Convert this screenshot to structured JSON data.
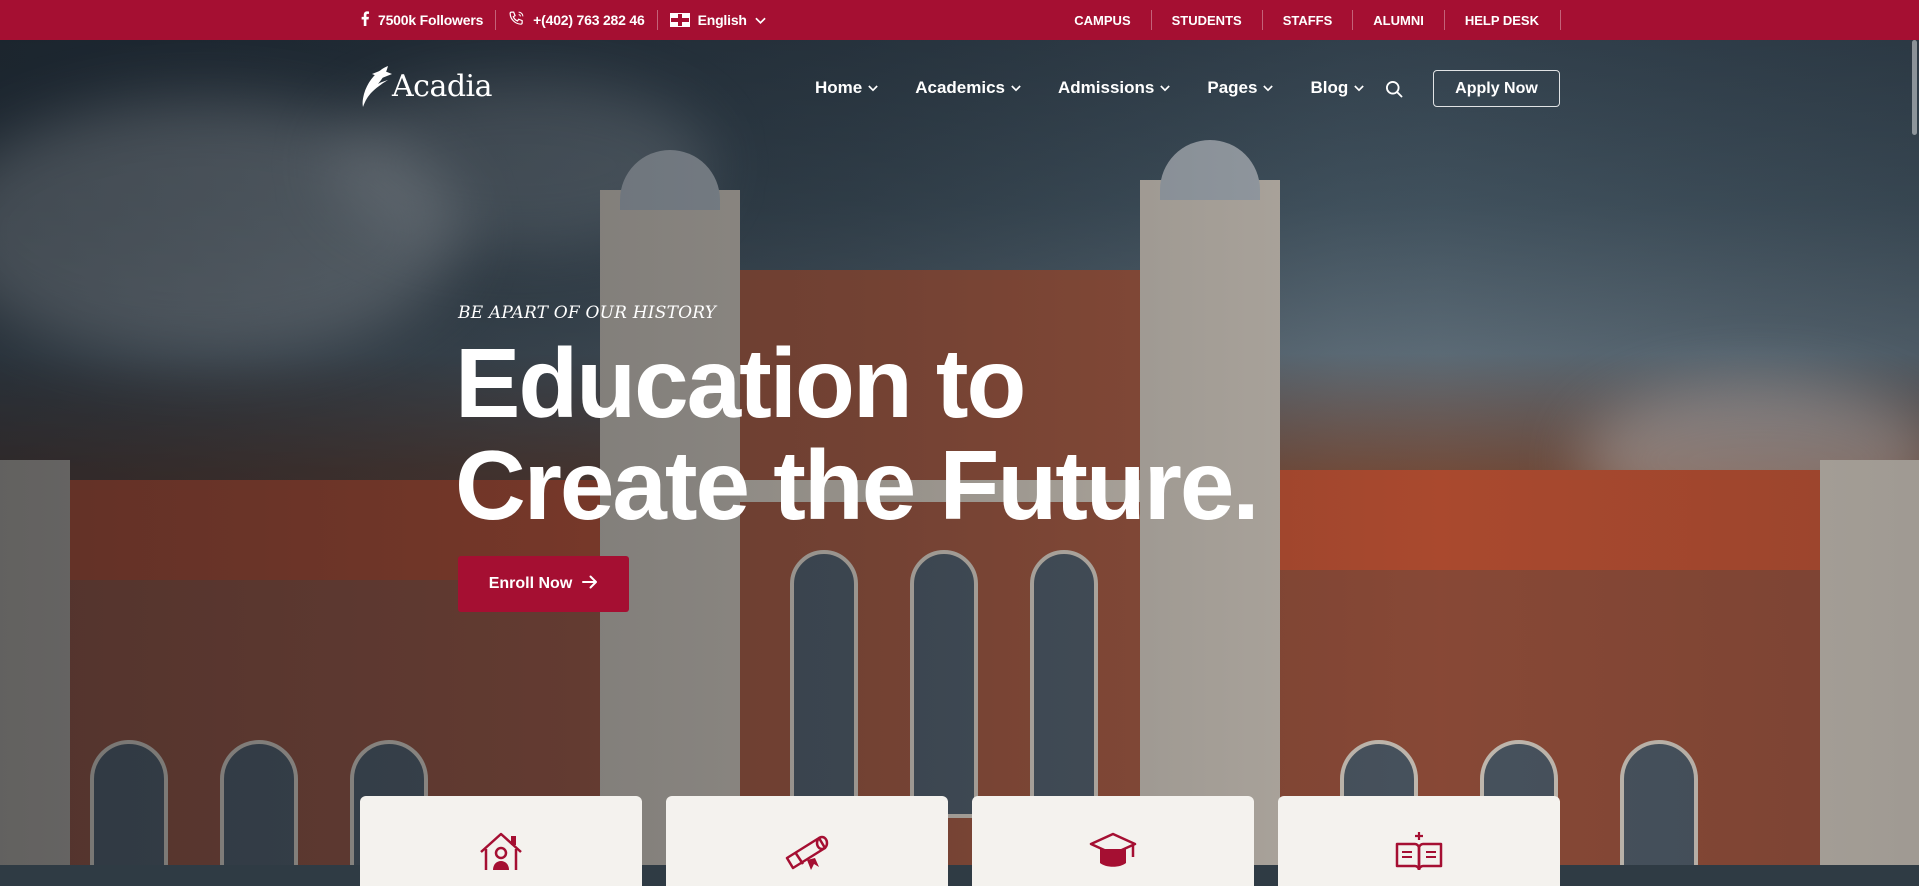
{
  "topbar": {
    "followers": "7500k Followers",
    "phone": "+(402) 763 282 46",
    "language": "English",
    "links": [
      "CAMPUS",
      "STUDENTS",
      "STAFFS",
      "ALUMNI",
      "HELP DESK"
    ]
  },
  "header": {
    "logo_text": "Acadia",
    "nav": [
      "Home",
      "Academics",
      "Admissions",
      "Pages",
      "Blog"
    ],
    "apply_label": "Apply Now"
  },
  "hero": {
    "eyebrow": "BE APART OF OUR HISTORY",
    "headline_line1": "Education to",
    "headline_line2": "Create the Future.",
    "enroll_label": "Enroll Now"
  },
  "cards": [
    {
      "icon": "campus-home-icon"
    },
    {
      "icon": "diploma-scroll-icon"
    },
    {
      "icon": "graduation-cap-icon"
    },
    {
      "icon": "open-book-icon"
    }
  ],
  "colors": {
    "brand": "#a50f32",
    "card_bg": "#f4f2ee",
    "text_light": "#ffffff"
  }
}
